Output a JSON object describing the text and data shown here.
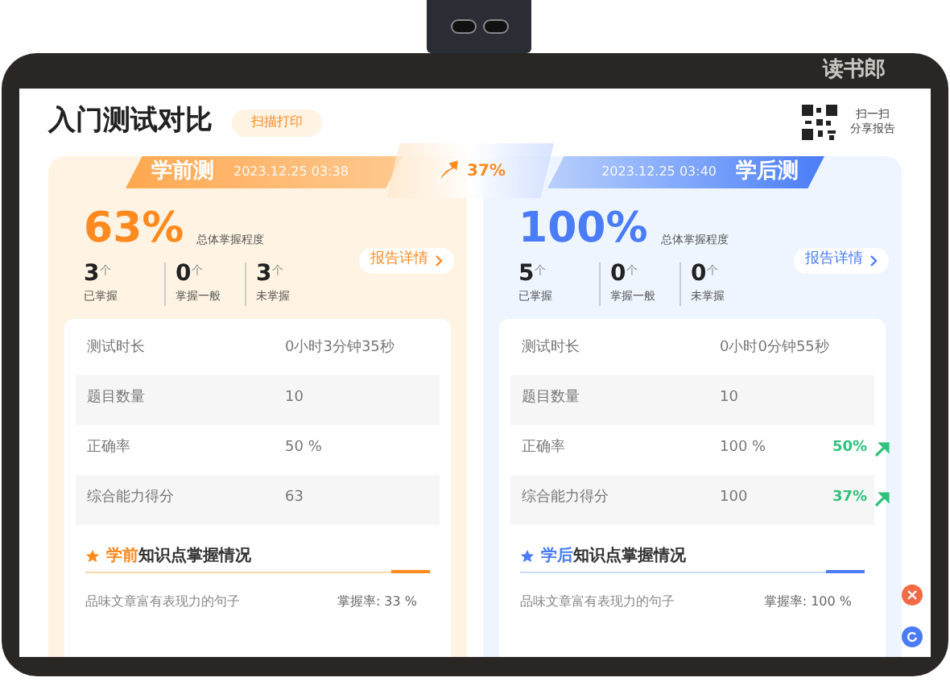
{
  "device": {
    "brand": "读书郎"
  },
  "header": {
    "title": "入门测试对比",
    "print_button": "扫描打印",
    "share": [
      "扫一扫",
      "分享报告"
    ]
  },
  "improvement": "37%",
  "panels": [
    {
      "kind": "before",
      "label": "学前测",
      "date": "2023.12.25 03:38",
      "percent": "63%",
      "percent_label": "总体掌握程度",
      "details_button": "报告详情",
      "counts": [
        {
          "value": "3",
          "unit": "个",
          "label": "已掌握"
        },
        {
          "value": "0",
          "unit": "个",
          "label": "掌握一般"
        },
        {
          "value": "3",
          "unit": "个",
          "label": "未掌握"
        }
      ],
      "metrics": [
        {
          "label": "测试时长",
          "value": "0小时3分钟35秒"
        },
        {
          "label": "题目数量",
          "value": "10"
        },
        {
          "label": "正确率",
          "value": "50 %"
        },
        {
          "label": "综合能力得分",
          "value": "63"
        }
      ],
      "section": {
        "highlight": "学前",
        "title": "知识点掌握情况"
      },
      "items": [
        {
          "name": "品味文章富有表现力的句子",
          "rate": "掌握率: 33 %"
        }
      ]
    },
    {
      "kind": "after",
      "label": "学后测",
      "date": "2023.12.25 03:40",
      "percent": "100%",
      "percent_label": "总体掌握程度",
      "details_button": "报告详情",
      "counts": [
        {
          "value": "5",
          "unit": "个",
          "label": "已掌握"
        },
        {
          "value": "0",
          "unit": "个",
          "label": "掌握一般"
        },
        {
          "value": "0",
          "unit": "个",
          "label": "未掌握"
        }
      ],
      "metrics": [
        {
          "label": "测试时长",
          "value": "0小时0分钟55秒"
        },
        {
          "label": "题目数量",
          "value": "10"
        },
        {
          "label": "正确率",
          "value": "100 %",
          "change": "50%"
        },
        {
          "label": "综合能力得分",
          "value": "100",
          "change": "37%"
        }
      ],
      "section": {
        "highlight": "学后",
        "title": "知识点掌握情况"
      },
      "items": [
        {
          "name": "品味文章富有表现力的句子",
          "rate": "掌握率: 100 %"
        }
      ]
    }
  ]
}
